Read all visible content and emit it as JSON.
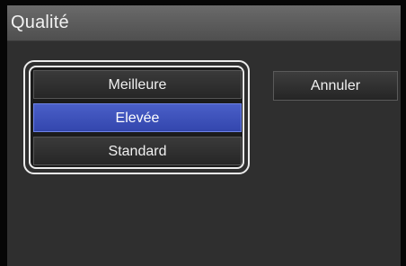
{
  "dialog": {
    "title": "Qualité"
  },
  "options": [
    {
      "label": "Meilleure",
      "selected": false
    },
    {
      "label": "Elevée",
      "selected": true
    },
    {
      "label": "Standard",
      "selected": false
    }
  ],
  "cancel_label": "Annuler",
  "colors": {
    "selection": "#3a4fbb",
    "background": "#2f2f2f",
    "title_bar": "#5b5b5b"
  }
}
